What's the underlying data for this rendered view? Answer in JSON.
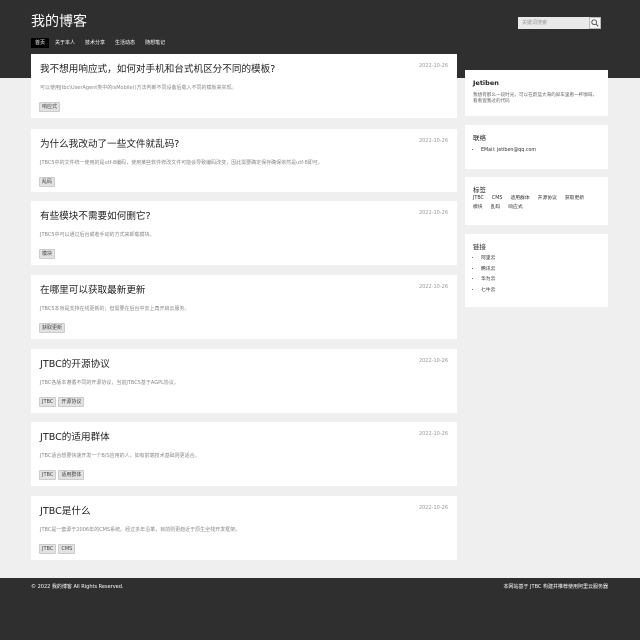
{
  "header": {
    "site_title": "我的博客",
    "nav": [
      "首页",
      "关于本人",
      "技术分享",
      "生活动态",
      "随想笔记"
    ],
    "search_placeholder": "关键词搜索"
  },
  "articles": [
    {
      "title": "我不想用响应式，如何对手机和台式机区分不同的模板?",
      "date": "2022-10-26",
      "summary": "可以使用Jtbc\\UserAgent类中的isMobile()方法判断不同设备后载入不同的模板来实现。",
      "tags": [
        "响应式"
      ]
    },
    {
      "title": "为什么我改动了一些文件就乱码?",
      "date": "2022-10-26",
      "summary": "JTBC5中的文件统一使用的是utf-8编码，使用某些软件修改文件可能会导致编码改变，因此需要确定保存确保依然是utf-8即可。",
      "tags": [
        "乱码"
      ]
    },
    {
      "title": "有些模块不需要如何删它?",
      "date": "2022-10-26",
      "summary": "JTBC5中可以通过后台或者手动的方式来卸载模块。",
      "tags": [
        "模块"
      ]
    },
    {
      "title": "在哪里可以获取最新更新",
      "date": "2022-10-26",
      "summary": "JTBC5本身是支持在线更新的，但需要在后台中去上角开启云服务。",
      "tags": [
        "获取更新"
      ]
    },
    {
      "title": "JTBC的开源协议",
      "date": "2022-10-26",
      "summary": "JTBC各版本遵循不同的开源协议，当前JTBC5基于AGPL协议。",
      "tags": [
        "JTBC",
        "开源协议"
      ]
    },
    {
      "title": "JTBC的适用群体",
      "date": "2022-10-26",
      "summary": "JTBC适合想要快速开发一个B/S应用的人，如有前端技术基础则更适合。",
      "tags": [
        "JTBC",
        "适用群体"
      ]
    },
    {
      "title": "JTBC是什么",
      "date": "2022-10-26",
      "summary": "JTBC是一套源于2006年的CMS系统。经过多年沿革，目前则更趋近于原生全栈开发框架。",
      "tags": [
        "JTBC",
        "CMS"
      ]
    }
  ],
  "sidebar": {
    "profile": {
      "name": "Jetiben",
      "bio": "我想有那么一段时光，可以在蔚蓝大海的屏车里看一杯咖啡，看看窗我过的代码"
    },
    "contact": {
      "title": "联络",
      "items": [
        "EMail: jetiben@qq.com"
      ]
    },
    "tags": {
      "title": "标签",
      "items": [
        "JTBC",
        "CMS",
        "适用群体",
        "开源协议",
        "获取更新",
        "模块",
        "乱码",
        "响应式"
      ]
    },
    "links": {
      "title": "链接",
      "items": [
        "阿里云",
        "腾讯云",
        "华为云",
        "七牛云"
      ]
    }
  },
  "footer": {
    "copyright": "© 2022 我的博客 All Rights Reserved.",
    "powered": "本网站基于 JTBC 构建并推荐使用阿里云服务器"
  }
}
